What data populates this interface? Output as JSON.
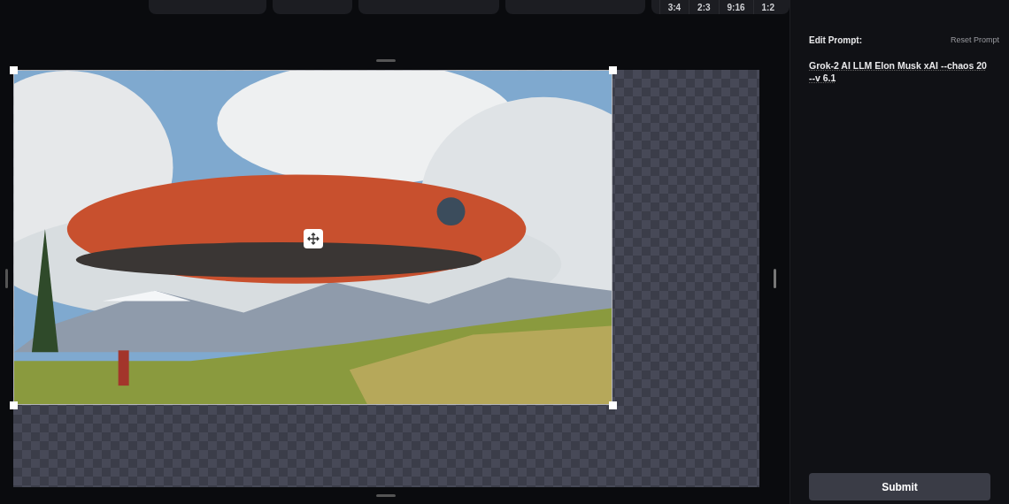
{
  "toolbar": {
    "aspect_ratios": [
      {
        "label": "3:4",
        "selected": false
      },
      {
        "label": "2:3",
        "selected": false
      },
      {
        "label": "9:16",
        "selected": false
      },
      {
        "label": "1:2",
        "selected": false
      }
    ]
  },
  "prompt_panel": {
    "title": "Edit Prompt:",
    "reset_link": "Reset Prompt",
    "prompt": "Grok-2 AI LLM Elon Musk xAI --chaos 20 --v 6.1",
    "submit": "Submit"
  }
}
